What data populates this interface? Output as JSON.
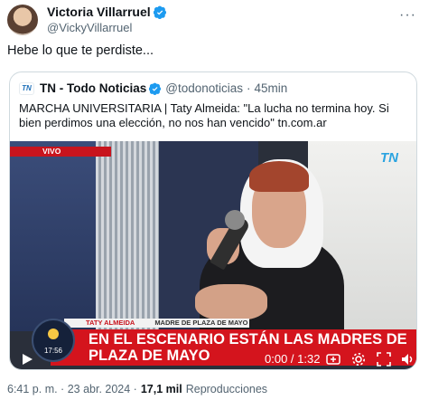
{
  "author": {
    "display_name": "Victoria Villarruel",
    "handle": "@VickyVillarruel",
    "verified": true
  },
  "tweet_text": "Hebe lo que te perdiste...",
  "quote": {
    "source_name": "TN - Todo Noticias",
    "source_handle": "@todonoticias",
    "time_ago": "45min",
    "text": "MARCHA UNIVERSITARIA | Taty Almeida: \"La lucha no termina hoy. Si bien perdimos una elección, no nos han vencido\"  tn.com.ar",
    "logo_text": "TN",
    "video": {
      "live_label": "VIVO",
      "watermark": "TN",
      "lower_third_name": "TATY ALMEIDA",
      "lower_third_role": "MADRE DE PLAZA DE MAYO",
      "headline": "EN EL ESCENARIO ESTÁN LAS MADRES DE PLAZA DE MAYO",
      "clock": "17:56",
      "time": "0:00 / 1:32"
    }
  },
  "footer": {
    "timestamp": "6:41 p. m. · 23 abr. 2024 ·",
    "views_count": "17,1 mil",
    "views_label": "Reproducciones"
  },
  "colors": {
    "verified": "#1d9bf0",
    "live_red": "#c8141d",
    "text_secondary": "#536471"
  },
  "icons": {
    "more": "more-icon",
    "play": "play-icon",
    "gif": "gif-icon",
    "settings": "settings-icon",
    "fullscreen": "fullscreen-icon",
    "mute": "volume-icon"
  }
}
